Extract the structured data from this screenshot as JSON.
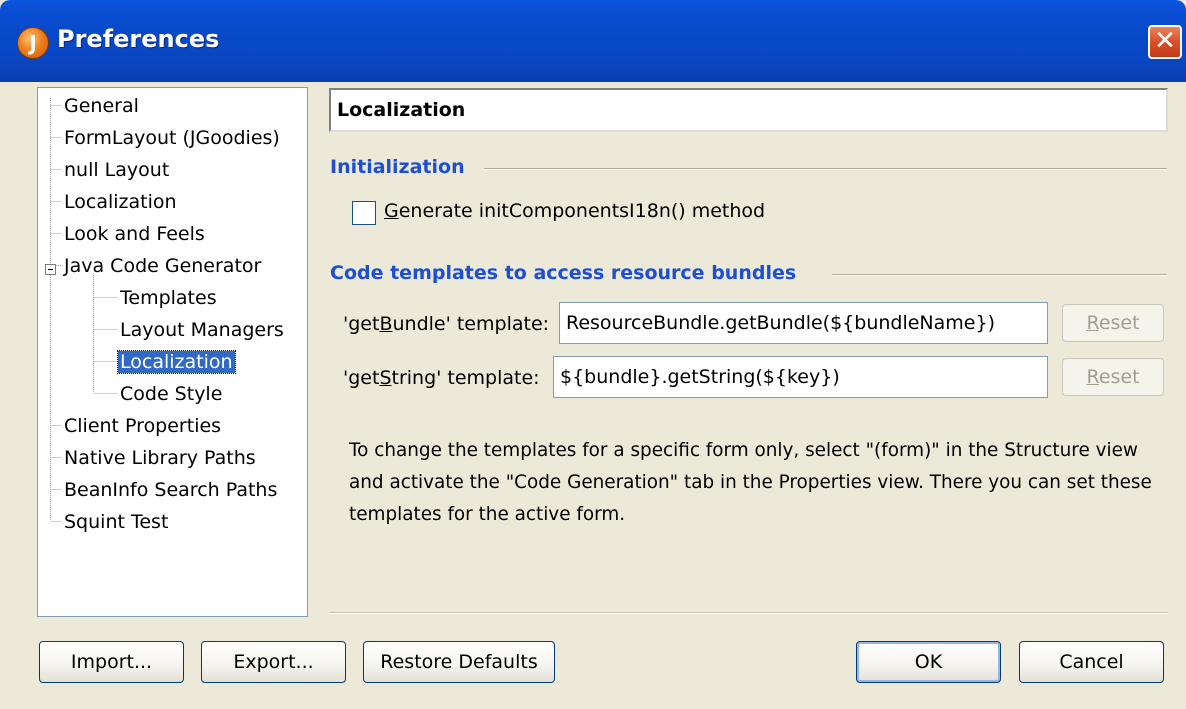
{
  "window": {
    "title": "Preferences",
    "icon_letter": "J",
    "close_glyph": "✕"
  },
  "tree": {
    "items": [
      {
        "label": "General",
        "level": 0
      },
      {
        "label": "FormLayout (JGoodies)",
        "level": 0
      },
      {
        "label": "null Layout",
        "level": 0
      },
      {
        "label": "Localization",
        "level": 0
      },
      {
        "label": "Look and Feels",
        "level": 0
      },
      {
        "label": "Java Code Generator",
        "level": 0,
        "expanded": true
      },
      {
        "label": "Templates",
        "level": 1
      },
      {
        "label": "Layout Managers",
        "level": 1
      },
      {
        "label": "Localization",
        "level": 1,
        "selected": true
      },
      {
        "label": "Code Style",
        "level": 1
      },
      {
        "label": "Client Properties",
        "level": 0
      },
      {
        "label": "Native Library Paths",
        "level": 0
      },
      {
        "label": "BeanInfo Search Paths",
        "level": 0
      },
      {
        "label": "Squint Test",
        "level": 0
      }
    ]
  },
  "page": {
    "header": "Localization",
    "init_section": "Initialization",
    "generate_checkbox": {
      "label_prefix": "",
      "mnemonic": "G",
      "label_rest": "enerate initComponentsI18n() method",
      "checked": false
    },
    "templates_section": "Code templates to access resource bundles",
    "getbundle": {
      "label_prefix": "'get",
      "mnemonic": "B",
      "label_rest": "undle' template:",
      "value": "ResourceBundle.getBundle(${bundleName})"
    },
    "getstring": {
      "label_prefix": "'get",
      "mnemonic": "S",
      "label_rest": "tring' template:",
      "value": "${bundle}.getString(${key})"
    },
    "reset_prefix": "",
    "reset_mnemonic": "R",
    "reset_rest": "eset",
    "info_text": "To change the templates for a specific form only, select \"(form)\" in the Structure view and activate the \"Code Generation\" tab in the Properties view. There you can set these templates for the active form."
  },
  "buttons": {
    "import": "Import...",
    "export": "Export...",
    "restore": "Restore Defaults",
    "ok": "OK",
    "cancel": "Cancel"
  },
  "colors": {
    "titlebar": "#0a4fd6",
    "section_title": "#1e4ed2",
    "selection": "#316ac5",
    "dialog_bg": "#ece9d8"
  }
}
